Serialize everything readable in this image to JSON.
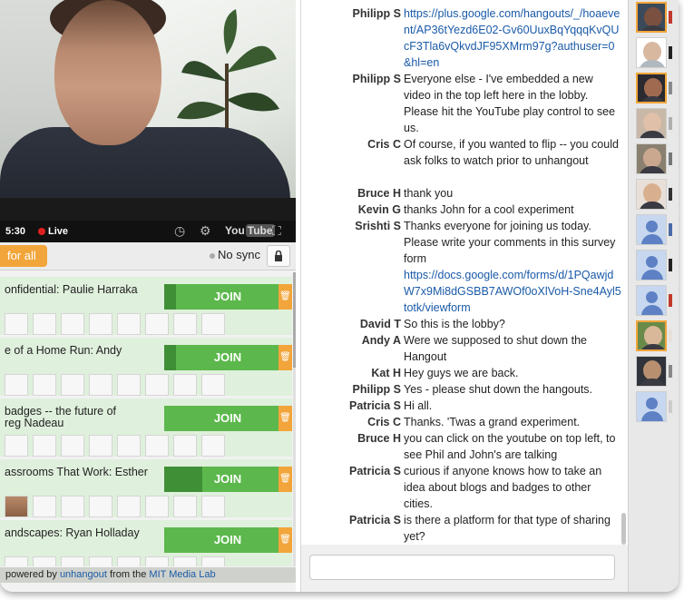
{
  "video": {
    "time": "5:30",
    "live_label": "Live",
    "clock_icon": "clock-icon",
    "gear_icon": "gear-icon",
    "youtube_label_a": "You",
    "youtube_label_b": "Tube",
    "fullscreen_icon": "fullscreen-icon"
  },
  "controls": {
    "for_all_label": "for all",
    "no_sync_label": "No sync",
    "lock_icon": "lock-icon"
  },
  "sessions": [
    {
      "title": "onfidential: Paulie Harraka",
      "join_label": "JOIN",
      "fill": 0.1,
      "faces": 0
    },
    {
      "title": "e of a Home Run: Andy",
      "join_label": "JOIN",
      "fill": 0.1,
      "faces": 0
    },
    {
      "title": "badges -- the future of\nreg Nadeau",
      "join_label": "JOIN",
      "fill": 0.0,
      "faces": 0
    },
    {
      "title": "assrooms That Work: Esther",
      "join_label": "JOIN",
      "fill": 0.33,
      "faces": 1
    },
    {
      "title": "andscapes: Ryan Holladay",
      "join_label": "JOIN",
      "fill": 0.0,
      "faces": 0
    }
  ],
  "footer": {
    "prefix": "powered by",
    "link1": "unhangout",
    "middle": "from the",
    "link2": "MIT Media Lab"
  },
  "chat": {
    "messages": [
      {
        "name": "Philipp S",
        "text": "https://plus.google.com/hangouts/_/hoaevent/AP36tYezd6E02-Gv60UuxBqYqqqKvQUcF3Tla6vQkvdJF95XMrm97g?authuser=0&hl=en",
        "link": true
      },
      {
        "name": "Philipp S",
        "text": "Everyone else - I've embedded a new video in the top left here in the lobby. Please hit the YouTube play control to see us.",
        "link": false
      },
      {
        "name": "Cris C",
        "text": "Of course, if you wanted to flip -- you could ask folks to watch prior to unhangout",
        "link": false
      },
      {
        "name": "Bruce H",
        "text": "thank you",
        "link": false
      },
      {
        "name": "Kevin G",
        "text": "thanks John for a cool experiment",
        "link": false
      },
      {
        "name": "Srishti S",
        "text": "Thanks everyone for joining us today. Please write your comments in this survey form",
        "link": false
      },
      {
        "name": "",
        "text": "https://docs.google.com/forms/d/1PQawjdW7x9Mi8dGSBB7AWOf0oXlVoH-Sne4Ayl5totk/viewform",
        "link": true
      },
      {
        "name": "David T",
        "text": "So this is the lobby?",
        "link": false
      },
      {
        "name": "Andy A",
        "text": "Were we supposed to shut down the Hangout",
        "link": false
      },
      {
        "name": "Kat H",
        "text": "Hey guys we are back.",
        "link": false
      },
      {
        "name": "Philipp S",
        "text": "Yes - please shut down the hangouts.",
        "link": false
      },
      {
        "name": "Patricia S",
        "text": "Hi all.",
        "link": false
      },
      {
        "name": "Cris C",
        "text": "Thanks. 'Twas a grand experiment.",
        "link": false
      },
      {
        "name": "Bruce H",
        "text": "you can click on the youtube on top left, to see Phil and John's are talking",
        "link": false
      },
      {
        "name": "Patricia S",
        "text": "curious if anyone knows how to take an idea about blogs and badges to other cities.",
        "link": false
      },
      {
        "name": "Patricia S",
        "text": "is there a platform for that type of sharing yet?",
        "link": false
      }
    ],
    "input_placeholder": ""
  },
  "people": {
    "avatars": [
      {
        "kind": "photo",
        "hl": true
      },
      {
        "kind": "photo",
        "hl": false
      },
      {
        "kind": "photo",
        "hl": true
      },
      {
        "kind": "photo",
        "hl": false
      },
      {
        "kind": "photo",
        "hl": false
      },
      {
        "kind": "photo",
        "hl": false
      },
      {
        "kind": "generic",
        "hl": false
      },
      {
        "kind": "generic",
        "hl": false
      },
      {
        "kind": "generic",
        "hl": false
      },
      {
        "kind": "photo",
        "hl": true
      },
      {
        "kind": "photo",
        "hl": false
      },
      {
        "kind": "generic",
        "hl": false
      }
    ]
  },
  "colors": {
    "join_green": "#5cb84c",
    "accent_orange": "#f2a53a",
    "link_blue": "#1a5aa8",
    "session_bg": "#dff0dc"
  }
}
